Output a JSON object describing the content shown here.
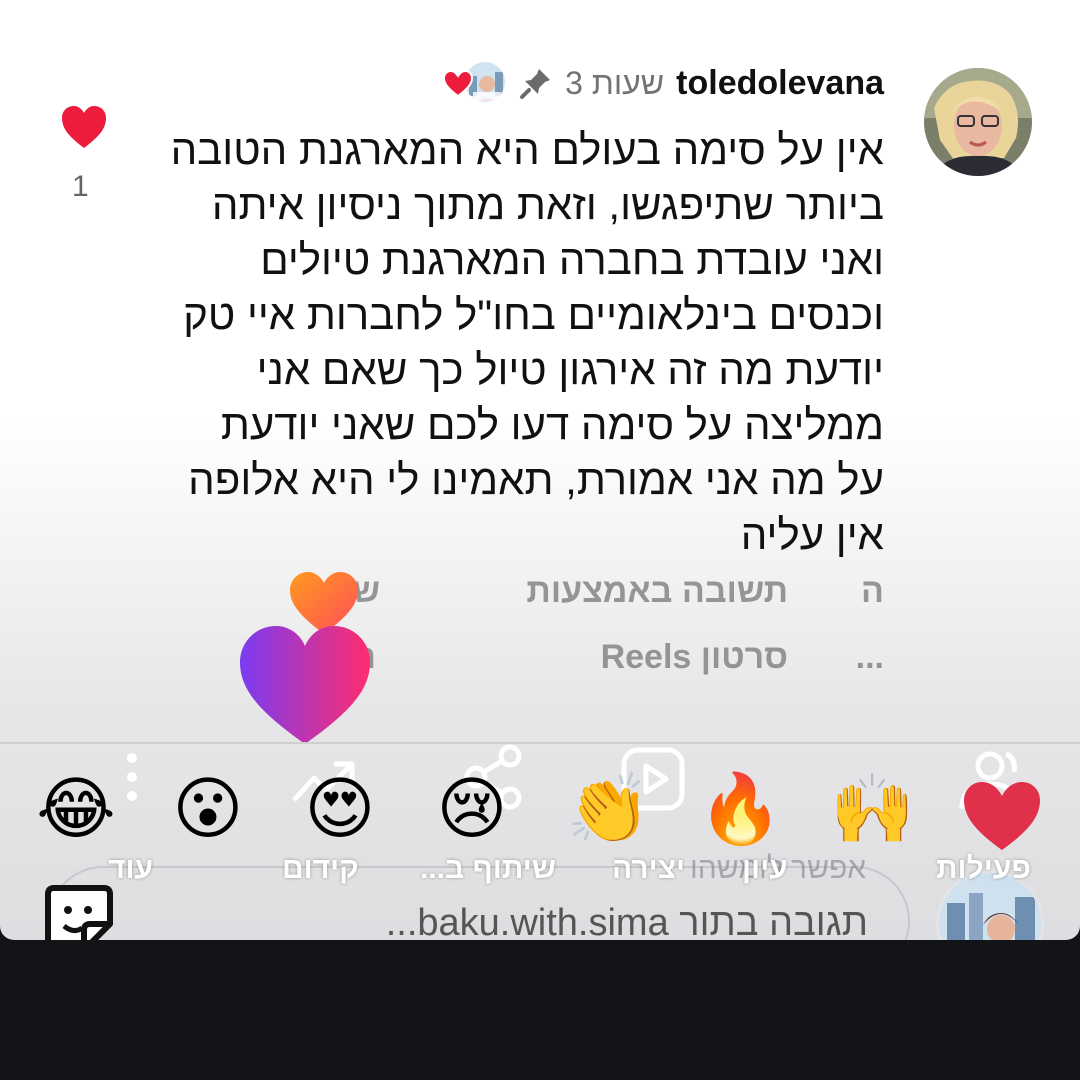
{
  "comment": {
    "username": "toledolevana",
    "time": "3 שעות",
    "text": "אין על סימה בעולם היא המארגנת הטובה ביותר שתיפגשו, וזאת מתוך ניסיון איתה ואני עובדת בחברה המארגנת טיולים וכנסים בינלאומיים בחו\"ל לחברות איי טק יודעת מה זה אירגון טיול כך שאם אני ממליצה על סימה דעו לכם שאני יודעת על מה אני אמורת, תאמינו לי היא אלופה אין עליה",
    "like_count": "1"
  },
  "actions": {
    "row1_left": "ה",
    "row1_mid": "תשובה באמצעות",
    "row1_right": "של   ת",
    "row2_left": "...",
    "row2_mid": "סרטון Reels",
    "row2_right": "ה"
  },
  "reactions": [
    "🙌",
    "🔥",
    "👏",
    "😢",
    "😍",
    "😮",
    "😂"
  ],
  "menu": {
    "activity": "פעילות",
    "view": "עיון",
    "create": "יצירה",
    "share": "שיתוף ב...",
    "promote": "קידום",
    "more": "עוד"
  },
  "ghost_text": "אפשר לומשהו",
  "reply": {
    "placeholder": "תגובה בתור baku.with.sima..."
  },
  "colors": {
    "like": "#ed1c3d",
    "gradient_start": "#7a3cf0",
    "gradient_end": "#ff2d6e",
    "orange_start": "#ff8a1e",
    "orange_end": "#ff4d5a"
  }
}
